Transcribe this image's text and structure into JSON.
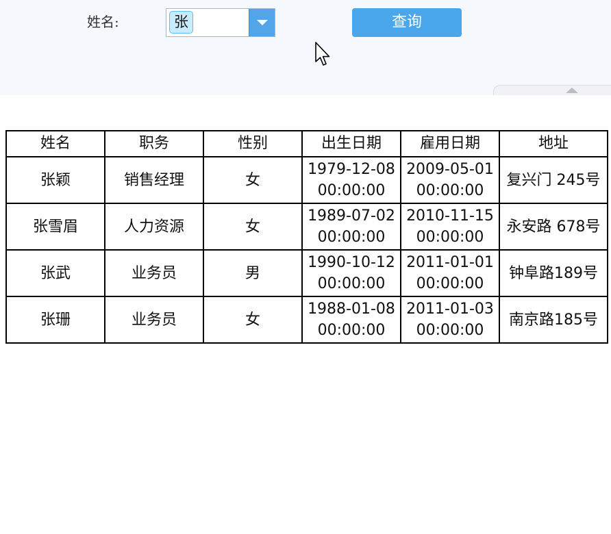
{
  "params": {
    "name_label": "姓名:",
    "name_selected": "张",
    "query_button": "查询"
  },
  "icons": {
    "dropdown": "chevron-down-icon",
    "collapse": "collapse-up-icon",
    "cursor": "mouse-pointer-icon"
  },
  "colors": {
    "pane_bg": "#f5f8fd",
    "accent": "#4aa7ec",
    "chip_bg": "#c7ecfd"
  },
  "table": {
    "headers": [
      "姓名",
      "职务",
      "性别",
      "出生日期",
      "雇用日期",
      "地址"
    ],
    "rows": [
      [
        "张颖",
        "销售经理",
        "女",
        "1979-12-08 00:00:00",
        "2009-05-01 00:00:00",
        "复兴门 245号"
      ],
      [
        "张雪眉",
        "人力资源",
        "女",
        "1989-07-02 00:00:00",
        "2010-11-15 00:00:00",
        "永安路 678号"
      ],
      [
        "张武",
        "业务员",
        "男",
        "1990-10-12 00:00:00",
        "2011-01-01 00:00:00",
        "钟阜路189号"
      ],
      [
        "张珊",
        "业务员",
        "女",
        "1988-01-08 00:00:00",
        "2011-01-03 00:00:00",
        "南京路185号"
      ]
    ]
  }
}
